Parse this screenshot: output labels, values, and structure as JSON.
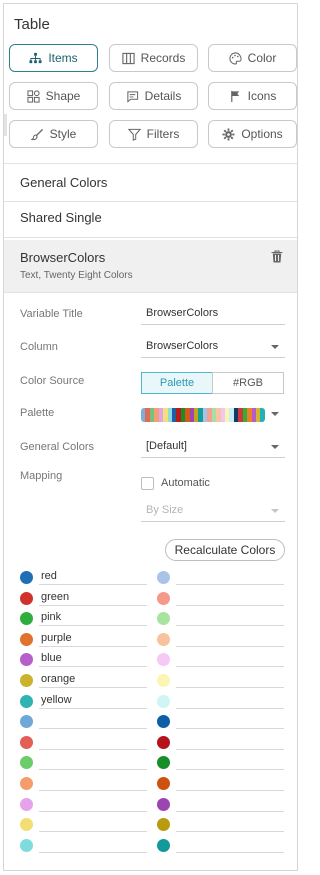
{
  "panel": {
    "title": "Table"
  },
  "tabs": [
    {
      "label": "Items",
      "icon": "hierarchy-icon",
      "active": true
    },
    {
      "label": "Records",
      "icon": "columns-icon",
      "active": false
    },
    {
      "label": "Color",
      "icon": "palette-icon",
      "active": false
    },
    {
      "label": "Shape",
      "icon": "shapes-icon",
      "active": false
    },
    {
      "label": "Details",
      "icon": "comment-icon",
      "active": false
    },
    {
      "label": "Icons",
      "icon": "flag-icon",
      "active": false
    },
    {
      "label": "Style",
      "icon": "brush-icon",
      "active": false
    },
    {
      "label": "Filters",
      "icon": "filter-icon",
      "active": false
    },
    {
      "label": "Options",
      "icon": "gear-icon",
      "active": false
    }
  ],
  "sections": {
    "general_colors": "General Colors",
    "shared_single": "Shared Single",
    "selected": {
      "title": "BrowserColors",
      "subtitle": "Text, Twenty Eight Colors"
    }
  },
  "props": {
    "variable_title_label": "Variable Title",
    "variable_title_value": "BrowserColors",
    "column_label": "Column",
    "column_value": "BrowserColors",
    "color_source_label": "Color Source",
    "color_source_options": [
      "Palette",
      "#RGB"
    ],
    "color_source_selected": "Palette",
    "palette_label": "Palette",
    "general_colors_label": "General Colors",
    "general_colors_value": "[Default]",
    "mapping_label": "Mapping",
    "automatic_label": "Automatic",
    "automatic_checked": false,
    "by_size_value": "By Size",
    "recalculate_label": "Recalculate Colors"
  },
  "palette_strip": [
    "#7eb0d6",
    "#e06a5c",
    "#7ac374",
    "#f1a07a",
    "#e0a6e4",
    "#f3e07a",
    "#8fdcdc",
    "#1f5fa6",
    "#b81b1b",
    "#1e8a2a",
    "#d25c17",
    "#9a47b4",
    "#c7a21c",
    "#139d9d",
    "#a6c4e6",
    "#f6a08f",
    "#a9dea0",
    "#f8c4a3",
    "#f1c6f0",
    "#fcf3b8",
    "#c9f0f0",
    "#14386a",
    "#cc3a35",
    "#2bb239",
    "#ef7d2a",
    "#b35ec6",
    "#d4b435",
    "#24b1b1"
  ],
  "colors_left": [
    {
      "name": "red",
      "color": "#1f6fb4"
    },
    {
      "name": "green",
      "color": "#d0312d"
    },
    {
      "name": "pink",
      "color": "#2fae3d"
    },
    {
      "name": "purple",
      "color": "#e0712f"
    },
    {
      "name": "blue",
      "color": "#b65ec9"
    },
    {
      "name": "orange",
      "color": "#cbb32b"
    },
    {
      "name": "yellow",
      "color": "#2fb3b3"
    },
    {
      "name": "",
      "color": "#6fa8d8"
    },
    {
      "name": "",
      "color": "#e35e55"
    },
    {
      "name": "",
      "color": "#6ccb6b"
    },
    {
      "name": "",
      "color": "#f59c6c"
    },
    {
      "name": "",
      "color": "#e6a2ea"
    },
    {
      "name": "",
      "color": "#f2de72"
    },
    {
      "name": "",
      "color": "#7fdcdc"
    }
  ],
  "colors_right": [
    {
      "name": "",
      "color": "#a9c4e6"
    },
    {
      "name": "",
      "color": "#f59a8a"
    },
    {
      "name": "",
      "color": "#a8e3a0"
    },
    {
      "name": "",
      "color": "#f8c29f"
    },
    {
      "name": "",
      "color": "#f5c8f5"
    },
    {
      "name": "",
      "color": "#fbf6b3"
    },
    {
      "name": "",
      "color": "#cff5f5"
    },
    {
      "name": "",
      "color": "#0d5ea6"
    },
    {
      "name": "",
      "color": "#b5121b"
    },
    {
      "name": "",
      "color": "#168f27"
    },
    {
      "name": "",
      "color": "#cf5110"
    },
    {
      "name": "",
      "color": "#9b45b3"
    },
    {
      "name": "",
      "color": "#b89b0f"
    },
    {
      "name": "",
      "color": "#11999b"
    }
  ]
}
